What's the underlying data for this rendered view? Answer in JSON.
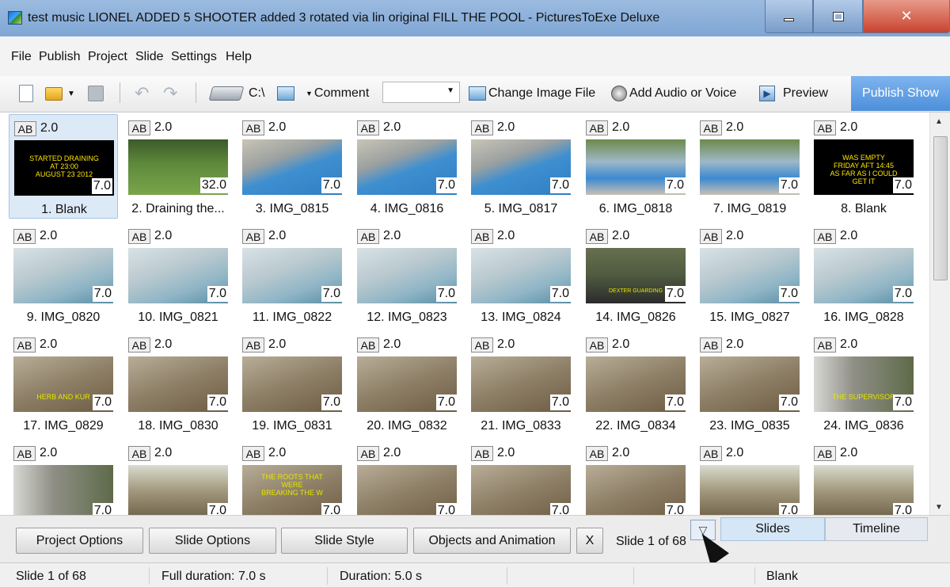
{
  "window": {
    "title": "test music LIONEL ADDED 5 SHOOTER added 3 rotated via lin original FILL THE POOL - PicturesToExe Deluxe",
    "close_glyph": "✕"
  },
  "menu": [
    "File",
    "Publish",
    "Project",
    "Slide",
    "Settings",
    "Help"
  ],
  "toolbar": {
    "drive_label": "C:\\",
    "comment_label": "Comment",
    "change_image_label": "Change Image File",
    "add_audio_label": "Add Audio or Voice",
    "preview_label": "Preview",
    "publish_label": "Publish Show"
  },
  "slides": [
    {
      "ab": "AB",
      "transition": "2.0",
      "duration": "7.0",
      "label": "1. Blank",
      "text": "STARTED  DRAINING\nAT  23:00\nAUGUST 23 2012",
      "bg": "black",
      "selected": true
    },
    {
      "ab": "AB",
      "transition": "2.0",
      "duration": "32.0",
      "label": "2. Draining the...",
      "text": "",
      "bg": "lawn"
    },
    {
      "ab": "AB",
      "transition": "2.0",
      "duration": "7.0",
      "label": "3. IMG_0815",
      "text": "",
      "bg": "pool"
    },
    {
      "ab": "AB",
      "transition": "2.0",
      "duration": "7.0",
      "label": "4. IMG_0816",
      "text": "",
      "bg": "pool"
    },
    {
      "ab": "AB",
      "transition": "2.0",
      "duration": "7.0",
      "label": "5. IMG_0817",
      "text": "",
      "bg": "pool"
    },
    {
      "ab": "AB",
      "transition": "2.0",
      "duration": "7.0",
      "label": "6. IMG_0818",
      "text": "",
      "bg": "yard"
    },
    {
      "ab": "AB",
      "transition": "2.0",
      "duration": "7.0",
      "label": "7. IMG_0819",
      "text": "",
      "bg": "yard"
    },
    {
      "ab": "AB",
      "transition": "2.0",
      "duration": "7.0",
      "label": "8. Blank",
      "text": "WAS EMPTY\nFRIDAY AFT 14:45\nAS FAR AS I COULD\nGET IT",
      "bg": "black"
    },
    {
      "ab": "AB",
      "transition": "2.0",
      "duration": "7.0",
      "label": "9. IMG_0820",
      "text": "",
      "bg": "empty"
    },
    {
      "ab": "AB",
      "transition": "2.0",
      "duration": "7.0",
      "label": "10. IMG_0821",
      "text": "",
      "bg": "empty"
    },
    {
      "ab": "AB",
      "transition": "2.0",
      "duration": "7.0",
      "label": "11. IMG_0822",
      "text": "",
      "bg": "empty"
    },
    {
      "ab": "AB",
      "transition": "2.0",
      "duration": "7.0",
      "label": "12. IMG_0823",
      "text": "",
      "bg": "empty"
    },
    {
      "ab": "AB",
      "transition": "2.0",
      "duration": "7.0",
      "label": "13. IMG_0824",
      "text": "",
      "bg": "empty"
    },
    {
      "ab": "AB",
      "transition": "2.0",
      "duration": "7.0",
      "label": "14. IMG_0826",
      "text": "DEXTER  GUARDING",
      "bg": "dog"
    },
    {
      "ab": "AB",
      "transition": "2.0",
      "duration": "7.0",
      "label": "15. IMG_0827",
      "text": "",
      "bg": "empty"
    },
    {
      "ab": "AB",
      "transition": "2.0",
      "duration": "7.0",
      "label": "16. IMG_0828",
      "text": "",
      "bg": "empty"
    },
    {
      "ab": "AB",
      "transition": "2.0",
      "duration": "7.0",
      "label": "17. IMG_0829",
      "text": "HERB AND KUR",
      "bg": "dirt"
    },
    {
      "ab": "AB",
      "transition": "2.0",
      "duration": "7.0",
      "label": "18. IMG_0830",
      "text": "",
      "bg": "dirt"
    },
    {
      "ab": "AB",
      "transition": "2.0",
      "duration": "7.0",
      "label": "19. IMG_0831",
      "text": "",
      "bg": "dirt"
    },
    {
      "ab": "AB",
      "transition": "2.0",
      "duration": "7.0",
      "label": "20. IMG_0832",
      "text": "",
      "bg": "dirt"
    },
    {
      "ab": "AB",
      "transition": "2.0",
      "duration": "7.0",
      "label": "21. IMG_0833",
      "text": "",
      "bg": "dirt"
    },
    {
      "ab": "AB",
      "transition": "2.0",
      "duration": "7.0",
      "label": "22. IMG_0834",
      "text": "",
      "bg": "dirt"
    },
    {
      "ab": "AB",
      "transition": "2.0",
      "duration": "7.0",
      "label": "23. IMG_0835",
      "text": "",
      "bg": "dirt"
    },
    {
      "ab": "AB",
      "transition": "2.0",
      "duration": "7.0",
      "label": "24. IMG_0836",
      "text": "THE SUPERVISOR",
      "bg": "porch"
    },
    {
      "ab": "AB",
      "transition": "2.0",
      "duration": "7.0",
      "label": "",
      "text": "",
      "bg": "porch"
    },
    {
      "ab": "AB",
      "transition": "2.0",
      "duration": "7.0",
      "label": "",
      "text": "",
      "bg": "machine"
    },
    {
      "ab": "AB",
      "transition": "2.0",
      "duration": "7.0",
      "label": "",
      "text": "THE ROOTS THAT\nWERE\nBREAKING THE W",
      "bg": "dirt"
    },
    {
      "ab": "AB",
      "transition": "2.0",
      "duration": "7.0",
      "label": "",
      "text": "",
      "bg": "dirt"
    },
    {
      "ab": "AB",
      "transition": "2.0",
      "duration": "7.0",
      "label": "",
      "text": "",
      "bg": "dirt"
    },
    {
      "ab": "AB",
      "transition": "2.0",
      "duration": "7.0",
      "label": "",
      "text": "",
      "bg": "dirt"
    },
    {
      "ab": "AB",
      "transition": "2.0",
      "duration": "7.0",
      "label": "",
      "text": "",
      "bg": "machine"
    },
    {
      "ab": "AB",
      "transition": "2.0",
      "duration": "7.0",
      "label": "",
      "text": "",
      "bg": "machine"
    }
  ],
  "bottom": {
    "project_options": "Project Options",
    "slide_options": "Slide Options",
    "slide_style": "Slide Style",
    "objects_animation": "Objects and Animation",
    "close_x": "X",
    "slide_counter": "Slide 1 of 68",
    "tab_slides": "Slides",
    "tab_timeline": "Timeline"
  },
  "status": {
    "slide": "Slide 1 of 68",
    "full_duration": "Full duration: 7.0 s",
    "duration": "Duration: 5.0 s",
    "name": "Blank"
  }
}
